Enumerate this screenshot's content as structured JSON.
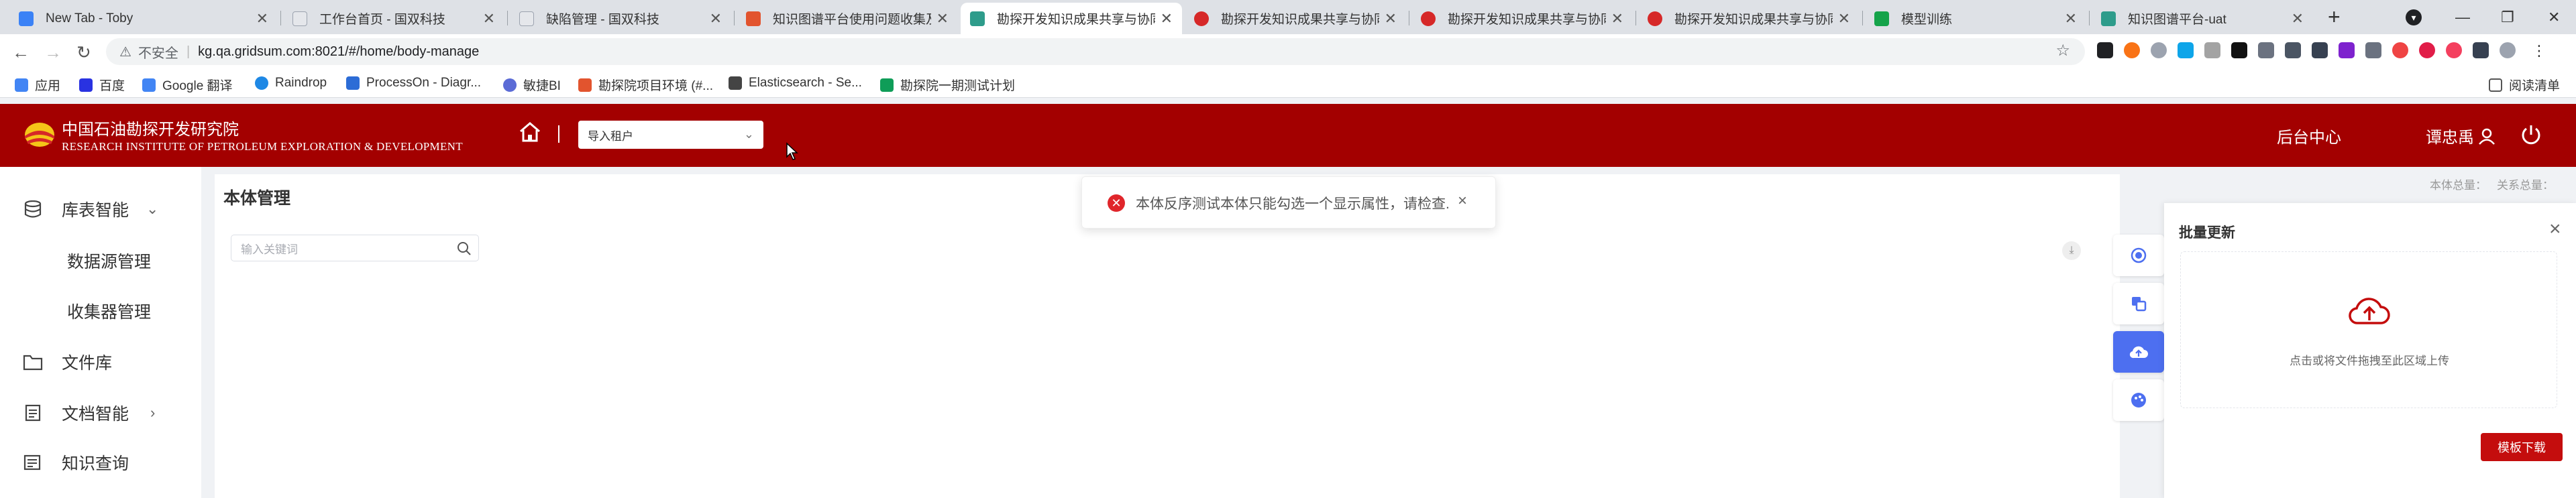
{
  "browser": {
    "tabs": [
      {
        "title": "New Tab - Toby",
        "fav_color": "#3b82f6"
      },
      {
        "title": "工作台首页 - 国双科技",
        "fav_color": "#6b7280"
      },
      {
        "title": "缺陷管理 - 国双科技",
        "fav_color": "#6b7280"
      },
      {
        "title": "知识图谱平台使用问题收集及...",
        "fav_color": "#e2542e"
      },
      {
        "title": "勘探开发知识成果共享与协同...",
        "fav_color": "#2e9c8b"
      },
      {
        "title": "勘探开发知识成果共享与协同...",
        "fav_color": "#d62828"
      },
      {
        "title": "勘探开发知识成果共享与协同...",
        "fav_color": "#d62828"
      },
      {
        "title": "勘探开发知识成果共享与协同...",
        "fav_color": "#d62828"
      },
      {
        "title": "模型训练",
        "fav_color": "#15a34a"
      },
      {
        "title": "知识图谱平台-uat",
        "fav_color": "#2e9c8b"
      }
    ],
    "new_tab_symbol": "+",
    "address": {
      "insecure_label": "不安全",
      "url": "kg.qa.gridsum.com:8021/#/home/body-manage"
    },
    "bookmarks": [
      {
        "label": "应用",
        "color": "#4285f4"
      },
      {
        "label": "百度",
        "color": "#2932e1"
      },
      {
        "label": "Google 翻译",
        "color": "#4285f4"
      },
      {
        "label": "Raindrop",
        "color": "#1e88e5"
      },
      {
        "label": "ProcessOn - Diagr...",
        "color": "#2c6cd6"
      },
      {
        "label": "敏捷BI",
        "color": "#5b6bd6"
      },
      {
        "label": "勘探院项目环境 (#...",
        "color": "#e2542e"
      },
      {
        "label": "Elasticsearch - Se...",
        "color": "#444444"
      },
      {
        "label": "勘探院一期测试计划",
        "color": "#0f9d58"
      }
    ],
    "reading_list": "阅读清单"
  },
  "header": {
    "org_cn": "中国石油勘探开发研究院",
    "org_en": "RESEARCH INSTITUTE OF PETROLEUM EXPLORATION & DEVELOPMENT",
    "tenant_select": "导入租户",
    "backend_link": "后台中心",
    "username": "谭忠禹"
  },
  "sidebar": {
    "items": [
      {
        "label": "库表智能",
        "icon": "database-icon",
        "expand": "chevron-down"
      },
      {
        "label": "数据源管理"
      },
      {
        "label": "收集器管理"
      },
      {
        "label": "文件库",
        "icon": "folder-icon"
      },
      {
        "label": "文档智能",
        "icon": "document-icon",
        "expand": "chevron-right"
      },
      {
        "label": "知识查询",
        "icon": "search-list-icon"
      }
    ]
  },
  "main": {
    "title": "本体管理",
    "search_placeholder": "输入关键词",
    "stat_body": "本体总量：",
    "stat_relation": "关系总量："
  },
  "toast": {
    "message": "本体反序测试本体只能勾选一个显示属性，请检查.",
    "type": "error"
  },
  "batch_panel": {
    "title": "批量更新",
    "upload_hint": "点击或将文件拖拽至此区域上传",
    "template_button": "模板下载"
  },
  "colors": {
    "brand_red": "#a30000",
    "button_red": "#c40d0d",
    "accent_blue": "#4d6ff0",
    "error_red": "#e0262b"
  }
}
